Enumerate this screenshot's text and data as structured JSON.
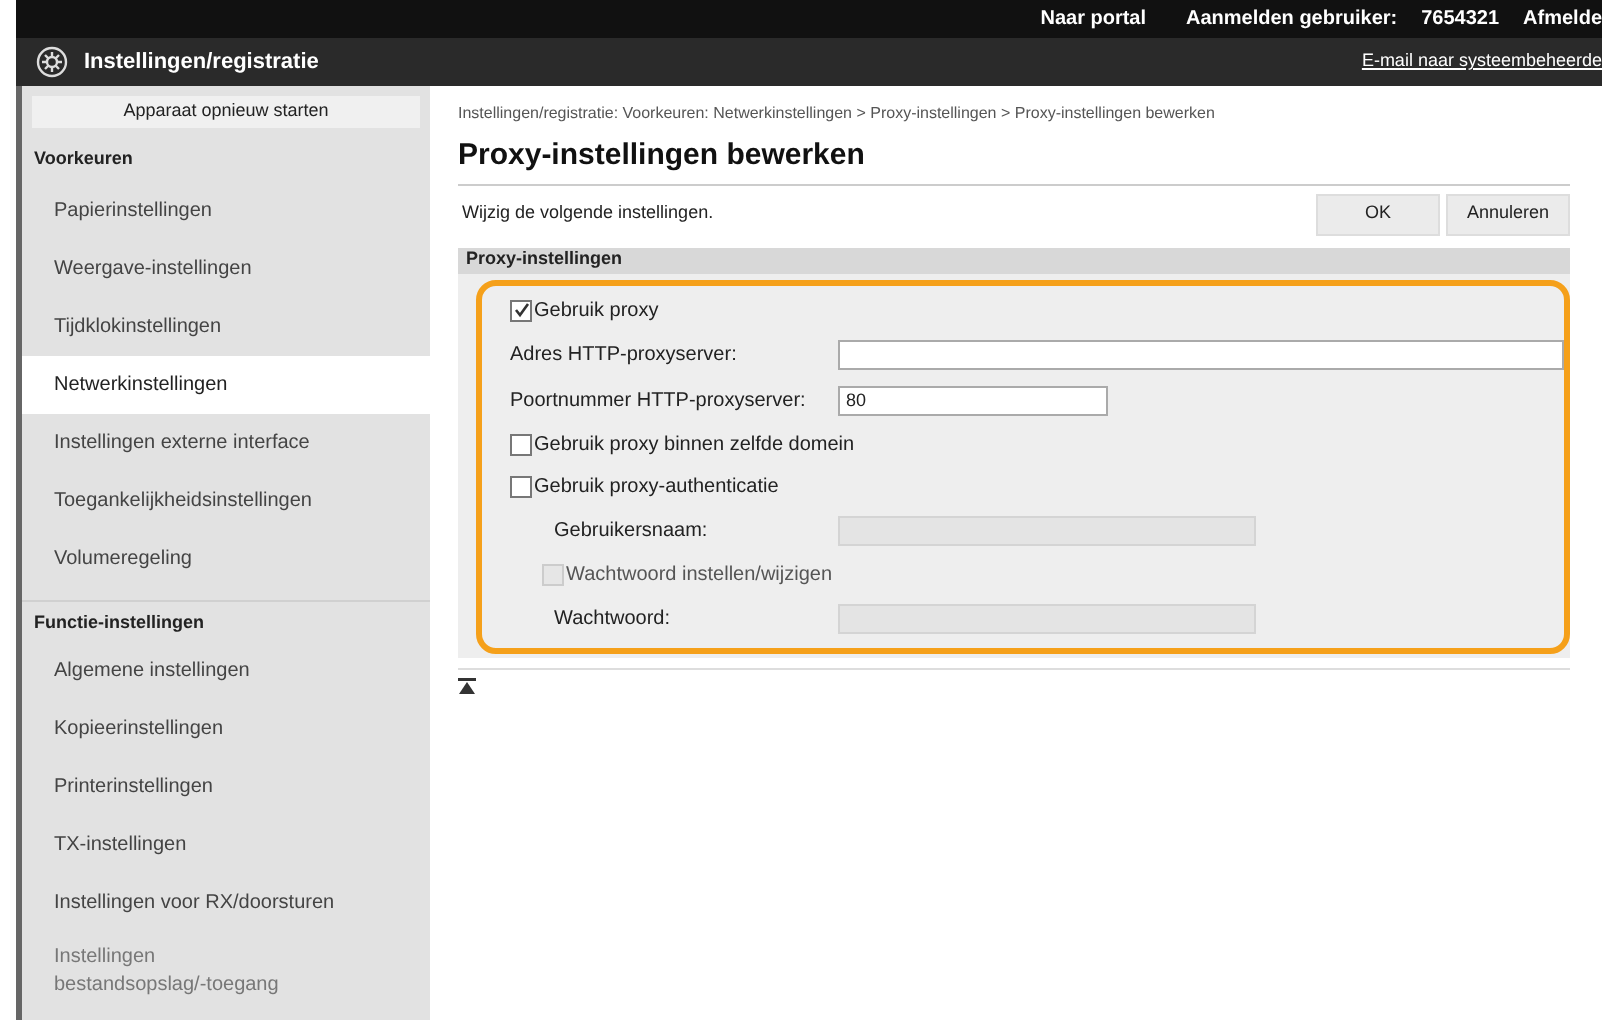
{
  "top_bar": {
    "links": [
      "Naar portal"
    ],
    "user_label": "Aanmelden gebruiker:",
    "user_id": "7654321",
    "logout": "Afmelde"
  },
  "header": {
    "title": "Instellingen/registratie",
    "mail_link": "E-mail naar systeembeheerde"
  },
  "sidebar": {
    "restart_button": "Apparaat opnieuw starten",
    "sections": [
      {
        "heading": "Voorkeuren",
        "items": [
          {
            "label": "Papierinstellingen",
            "selected": false
          },
          {
            "label": "Weergave-instellingen",
            "selected": false
          },
          {
            "label": "Tijdklokinstellingen",
            "selected": false
          },
          {
            "label": "Netwerkinstellingen",
            "selected": true
          },
          {
            "label": "Instellingen externe interface",
            "selected": false
          },
          {
            "label": "Toegankelijkheidsinstellingen",
            "selected": false
          },
          {
            "label": "Volumeregeling",
            "selected": false
          }
        ]
      },
      {
        "heading": "Functie-instellingen",
        "items": [
          {
            "label": "Algemene instellingen",
            "selected": false
          },
          {
            "label": "Kopieerinstellingen",
            "selected": false
          },
          {
            "label": "Printerinstellingen",
            "selected": false
          },
          {
            "label": "TX-instellingen",
            "selected": false
          },
          {
            "label": "Instellingen voor RX/doorsturen",
            "selected": false
          }
        ]
      }
    ],
    "faded_item": [
      "Instellingen",
      "bestandsopslag/-toegang"
    ]
  },
  "breadcrumb": "Instellingen/registratie: Voorkeuren: Netwerkinstellingen > Proxy-instellingen > Proxy-instellingen bewerken",
  "page_title": "Proxy-instellingen bewerken",
  "instruction": "Wijzig de volgende instellingen.",
  "buttons": [
    "OK",
    "Annuleren"
  ],
  "section_title": "Proxy-instellingen",
  "rows": [
    {
      "kind": "checkbox",
      "label": "Gebruik proxy",
      "checked": true,
      "disabled": false
    },
    {
      "kind": "wide_field",
      "label": "Adres HTTP-proxyserver:",
      "value": "",
      "disabled": false
    },
    {
      "kind": "field",
      "label": "Poortnummer HTTP-proxyserver:",
      "value": "80",
      "disabled": false
    },
    {
      "kind": "checkbox",
      "label": "Gebruik proxy binnen zelfde domein",
      "checked": false,
      "disabled": false
    },
    {
      "kind": "checkbox",
      "label": "Gebruik proxy-authenticatie",
      "checked": false,
      "disabled": false
    },
    {
      "kind": "sub_field",
      "label": "Gebruikersnaam:",
      "value": "",
      "disabled": true
    },
    {
      "kind": "sub_checkbox",
      "label": "Wachtwoord instellen/wijzigen",
      "checked": false,
      "disabled": true
    },
    {
      "kind": "sub_field",
      "label": "Wachtwoord:",
      "value": "",
      "disabled": true
    }
  ]
}
